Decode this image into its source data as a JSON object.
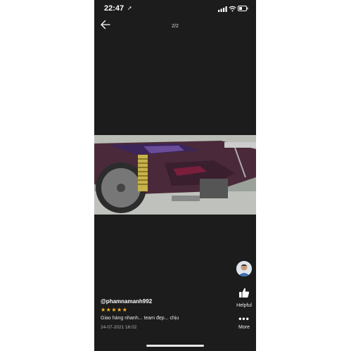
{
  "status_bar": {
    "time": "22:47",
    "location_glyph": "➚",
    "signal_icon": "cellular-signal-icon",
    "wifi_icon": "wifi-icon",
    "battery_icon": "battery-icon"
  },
  "viewer": {
    "back_icon": "back-arrow-icon",
    "counter": "2/2"
  },
  "review": {
    "username": "@phamnamanh992",
    "stars": "★★★★★",
    "rating": 5,
    "comment": "Giao hàng nhanh... team đẹp... chịu",
    "date": "24-07-2021 16:02"
  },
  "actions": {
    "helpful_label": "Helpful",
    "more_label": "More",
    "more_glyph": "•••"
  },
  "colors": {
    "background": "#1c1c1c",
    "star": "#f5b322",
    "text": "#ffffff"
  }
}
